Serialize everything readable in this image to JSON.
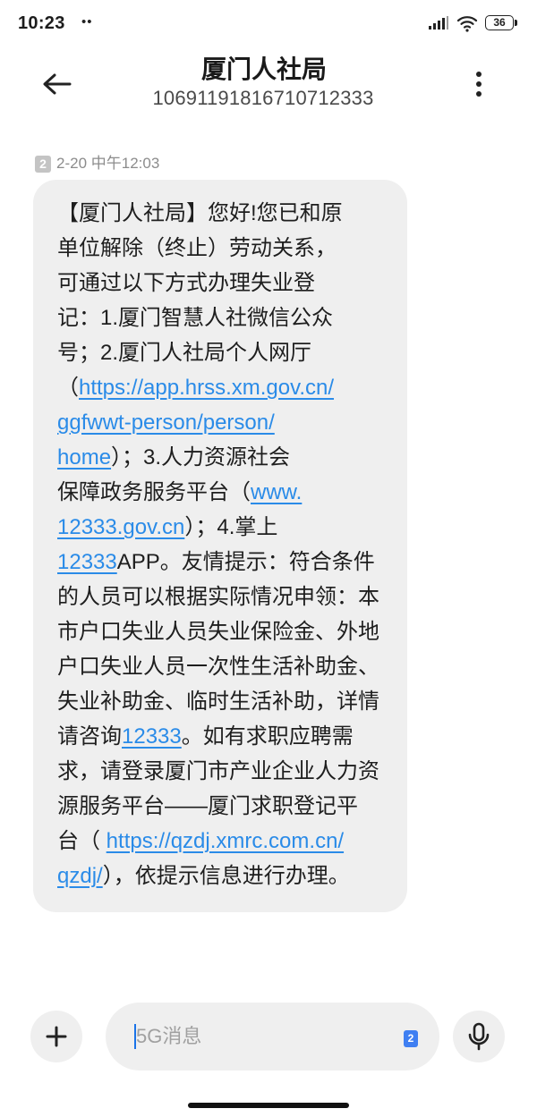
{
  "status_bar": {
    "time": "10:23",
    "notification_indicator": "••",
    "battery_level": "36",
    "icons": [
      "signal-icon",
      "wifi-icon",
      "battery-icon"
    ]
  },
  "header": {
    "title": "厦门人社局",
    "sender_number": "10691191816710712333",
    "icons": {
      "back": "back-arrow-icon",
      "menu": "more-vert-icon"
    }
  },
  "message": {
    "sim_slot": "2",
    "timestamp": "2-20 中午12:03",
    "lines": [
      [
        {
          "text": "【厦门人社局】您好!您已和原"
        }
      ],
      [
        {
          "text": "单位解除（终止）劳动关系，"
        }
      ],
      [
        {
          "text": "可通过以下方式办理失业登"
        }
      ],
      [
        {
          "text": "记：1.厦门智慧人社微信公众"
        }
      ],
      [
        {
          "text": "号；2.厦门人社局个人网厅"
        }
      ],
      [
        {
          "text": "（"
        },
        {
          "link": "https://app.hrss.xm.gov.cn/"
        }
      ],
      [
        {
          "link": "ggfwwt-person/person/"
        }
      ],
      [
        {
          "link": "home"
        },
        {
          "text": "）；3.人力资源社会"
        }
      ],
      [
        {
          "text": "保障政务服务平台（"
        },
        {
          "link": "www."
        }
      ],
      [
        {
          "link": "12333.gov.cn"
        },
        {
          "text": "）；4.掌上"
        }
      ],
      [
        {
          "link": "12333"
        },
        {
          "text": "APP。友情提示：符合条件"
        }
      ],
      [
        {
          "text": "的人员可以根据实际情况申领：本"
        }
      ],
      [
        {
          "text": "市户口失业人员失业保险金、外地"
        }
      ],
      [
        {
          "text": "户口失业人员一次性生活补助金、"
        }
      ],
      [
        {
          "text": "失业补助金、临时生活补助，详情"
        }
      ],
      [
        {
          "text": "请咨询"
        },
        {
          "link": "12333"
        },
        {
          "text": "。如有求职应聘需"
        }
      ],
      [
        {
          "text": "求，请登录厦门市产业企业人力资"
        }
      ],
      [
        {
          "text": "源服务平台——厦门求职登记平"
        }
      ],
      [
        {
          "text": "台（ "
        },
        {
          "link": "https://qzdj.xmrc.com.cn/"
        }
      ],
      [
        {
          "link": "qzdj/"
        },
        {
          "text": "），依提示信息进行办理。"
        }
      ]
    ]
  },
  "composer": {
    "placeholder": "5G消息",
    "value": "",
    "sim_slot": "2",
    "icons": {
      "attach": "plus-icon",
      "voice": "mic-icon"
    }
  },
  "colors": {
    "background": "#ffffff",
    "bubble": "#efefef",
    "link": "#2a8be8",
    "cursor": "#1a73e8",
    "sim_badge_active": "#3f7ff2",
    "sim_badge_muted": "#c4c4c4"
  }
}
